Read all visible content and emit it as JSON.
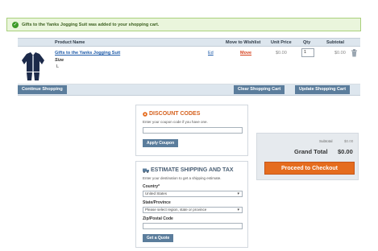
{
  "notice": {
    "message": "Gifts to the Yanks Jogging Suit was added to your shopping cart."
  },
  "cart": {
    "columns": {
      "product_name": "Product Name",
      "move": "Move to Wishlist",
      "unit_price": "Unit Price",
      "qty": "Qty",
      "subtotal": "Subtotal"
    },
    "item": {
      "name": "Gifts to the Yanks Jogging Suit",
      "option_label": "Size",
      "option_value": "L",
      "edit_label": "Ed",
      "move_label": "Move",
      "unit_price": "$0.00",
      "qty": "1",
      "subtotal": "$0.00",
      "image_icon": "jacket-icon"
    },
    "buttons": {
      "continue": "Continue Shopping",
      "clear": "Clear Shopping Cart",
      "update": "Update Shopping Cart"
    }
  },
  "discount": {
    "title": "DISCOUNT CODES",
    "description": "Enter your coupon code if you have one.",
    "input_value": "",
    "button": "Apply Coupon",
    "icon": "tag-icon"
  },
  "shipping": {
    "title": "ESTIMATE SHIPPING AND TAX",
    "description": "Enter your destination to get a shipping estimate.",
    "country_label": "Country*",
    "country_value": "United States",
    "state_label": "State/Province",
    "state_value": "Please select region, state or province",
    "zip_label": "Zip/Postal Code",
    "zip_value": "",
    "button": "Get a Quote",
    "icon": "truck-icon"
  },
  "totals": {
    "subtotal_label": "Subtotal",
    "subtotal_value": "$0.00",
    "grand_label": "Grand Total",
    "grand_value": "$0.00",
    "checkout": "Proceed to Checkout"
  },
  "colors": {
    "accent": "#e56c1e",
    "link": "#1d5aa8",
    "button": "#5b7d9c",
    "success": "#3d9a28"
  }
}
